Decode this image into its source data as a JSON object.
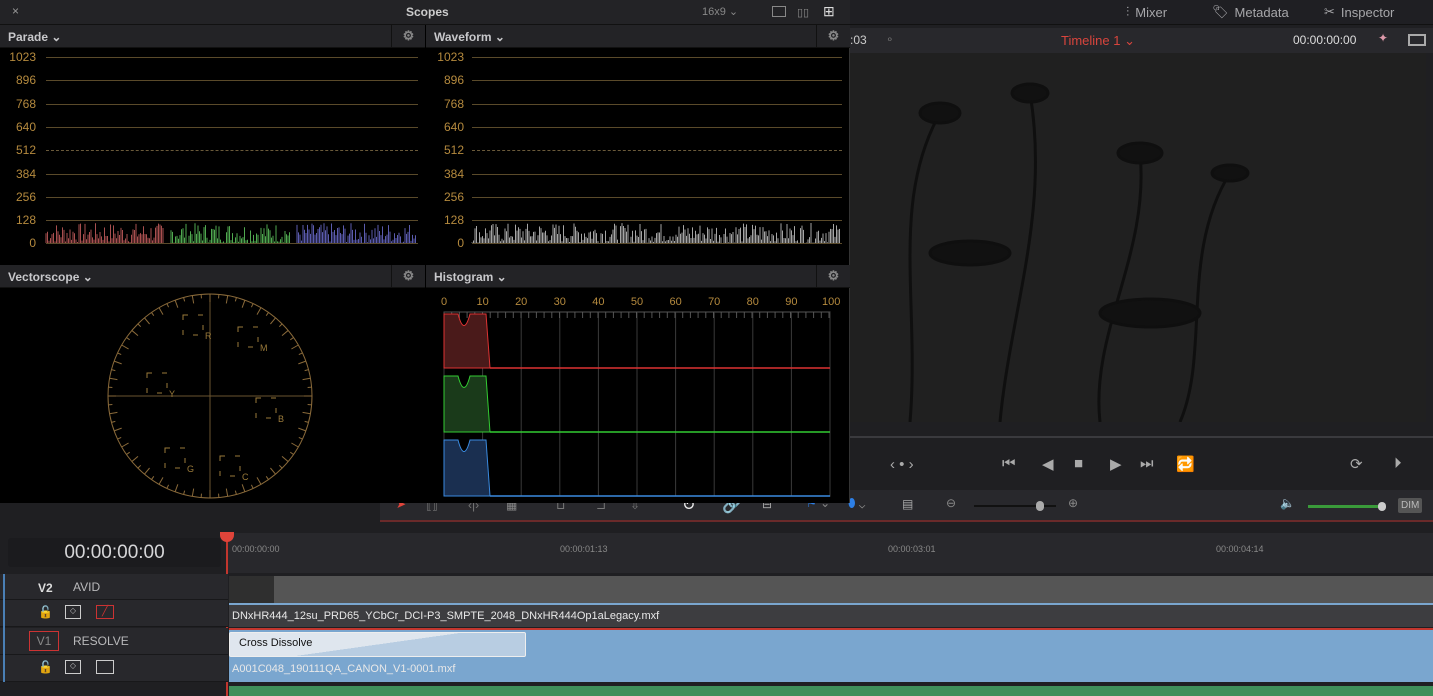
{
  "scopes": {
    "title": "Scopes",
    "aspect": "16x9",
    "close": "×",
    "parade": {
      "title": "Parade"
    },
    "waveform": {
      "title": "Waveform"
    },
    "vectorscope": {
      "title": "Vectorscope"
    },
    "histogram": {
      "title": "Histogram"
    },
    "levels": [
      "1023",
      "896",
      "768",
      "640",
      "512",
      "384",
      "256",
      "128",
      "0"
    ],
    "hist_ticks": [
      "0",
      "10",
      "20",
      "30",
      "40",
      "50",
      "60",
      "70",
      "80",
      "90",
      "100"
    ],
    "vector_targets": [
      "R",
      "M",
      "Y",
      "B",
      "G",
      "C"
    ]
  },
  "topbar": {
    "mixer": "Mixer",
    "metadata": "Metadata",
    "inspector": "Inspector"
  },
  "viewer": {
    "left_tc": ":03",
    "timeline_name": "Timeline 1",
    "timecode": "00:00:00:00"
  },
  "toolbar": {
    "dim": "DIM",
    "volume": 0.9,
    "zoom": 0.6
  },
  "timeline": {
    "timecode": "00:00:00:00",
    "ruler": [
      "00:00:00:00",
      "00:00:01:13",
      "00:00:03:01",
      "00:00:04:14"
    ],
    "tracks": [
      {
        "id": "V2",
        "name": "AVID",
        "clip": "DNxHR444_12su_PRD65_YCbCr_DCI-P3_SMPTE_2048_DNxHR444Op1aLegacy.mxf"
      },
      {
        "id": "V1",
        "name": "RESOLVE",
        "clip": "A001C048_190111QA_CANON_V1-0001.mxf",
        "transition": "Cross Dissolve"
      }
    ]
  },
  "colors": {
    "accent_red": "#e0443a",
    "clip_blue": "#7aa6cf",
    "audio_green": "#3f8f5a",
    "scope_gold": "#b58a3e"
  }
}
